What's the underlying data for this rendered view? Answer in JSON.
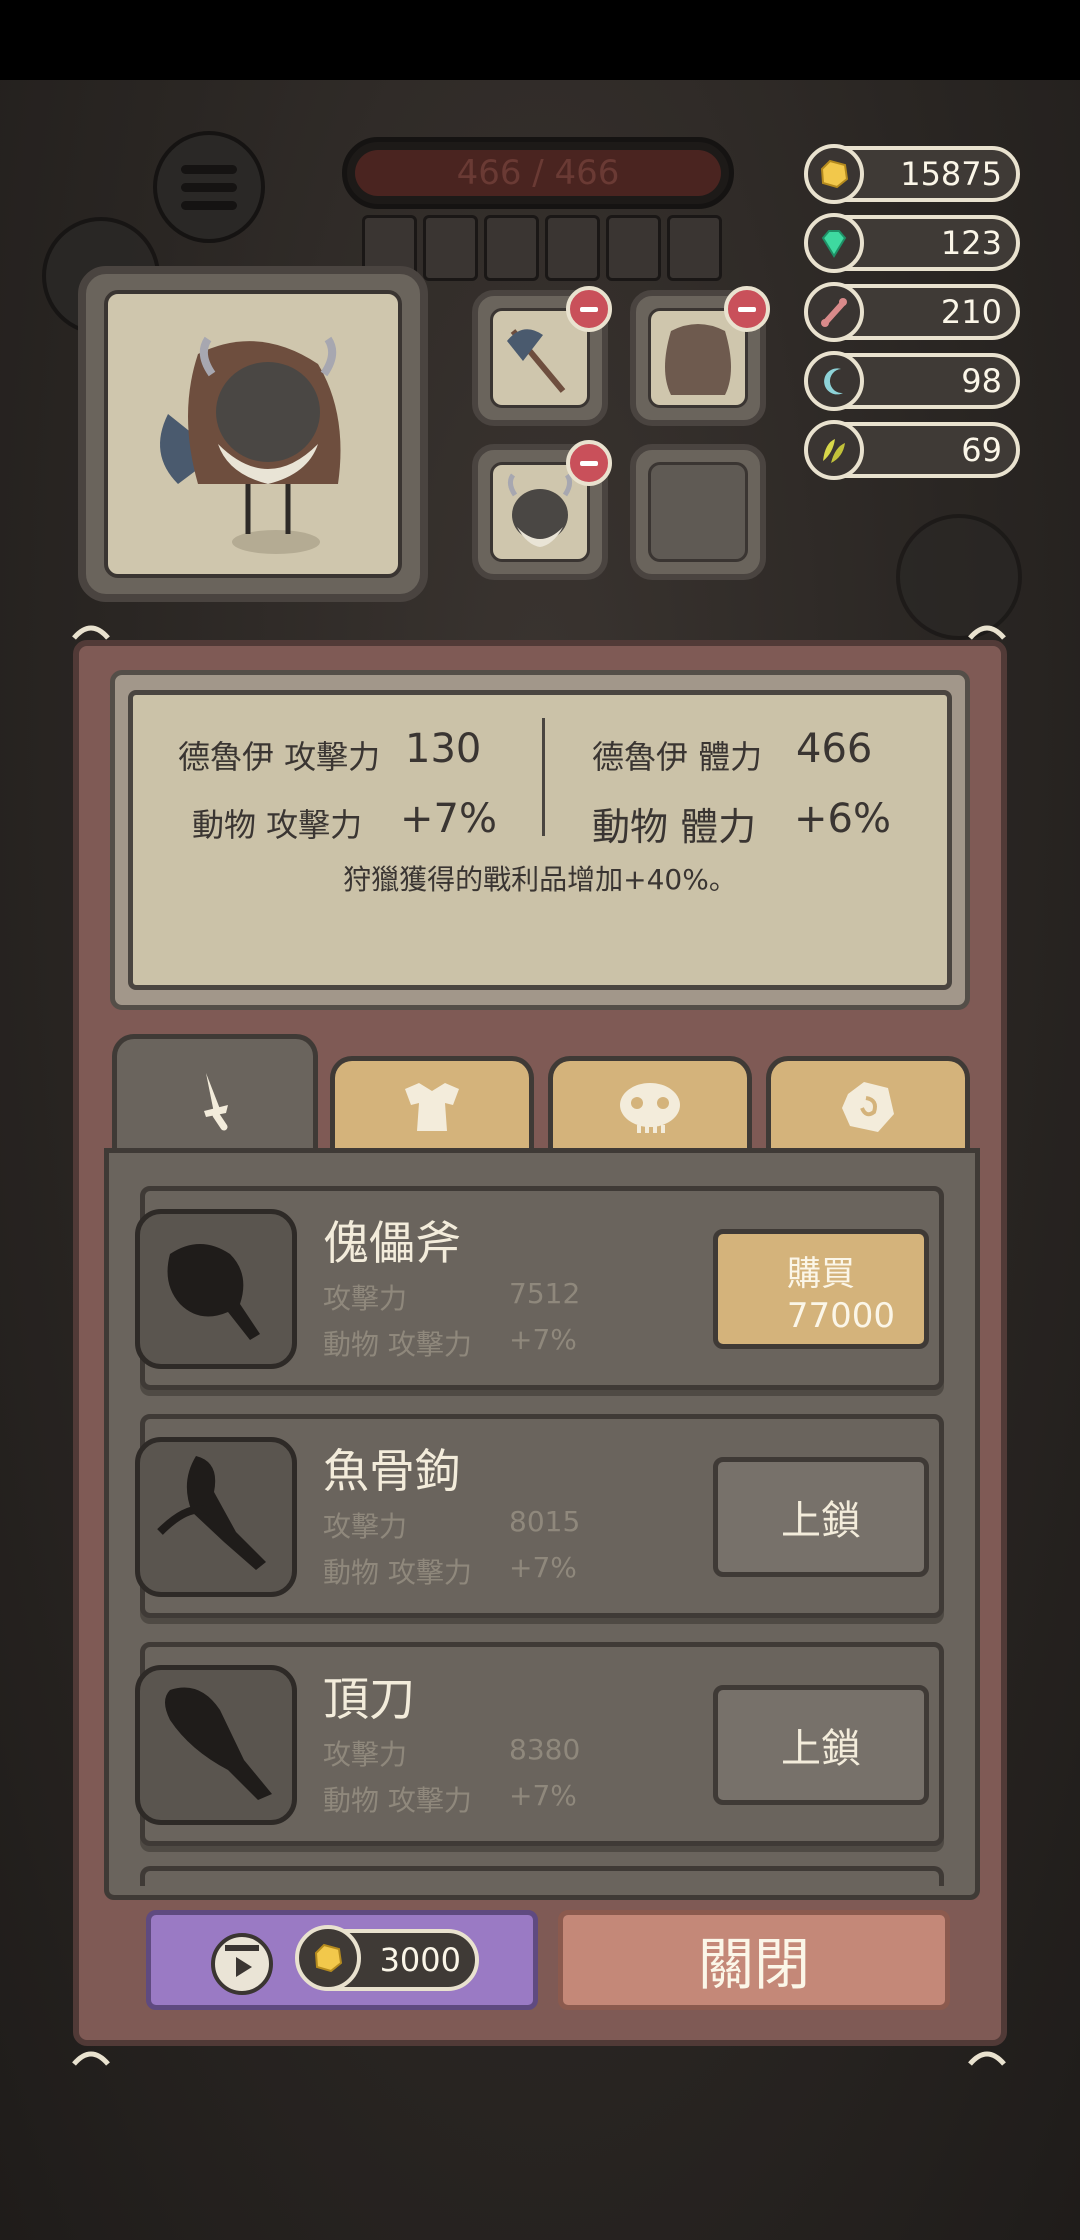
{
  "hud": {
    "hp_text": "466 / 466",
    "resources": [
      {
        "icon": "gold-icon",
        "value": "15875",
        "color": "#f2c84b"
      },
      {
        "icon": "gem-icon",
        "value": "123",
        "color": "#3ed9a0"
      },
      {
        "icon": "bone-icon",
        "value": "210",
        "color": "#d98a8a"
      },
      {
        "icon": "moon-claw-icon",
        "value": "98",
        "color": "#8ed3d8"
      },
      {
        "icon": "leaf-icon",
        "value": "69",
        "color": "#d8d84a"
      }
    ]
  },
  "stats": {
    "druid_attack_label": "德魯伊 攻擊力",
    "druid_attack_value": "130",
    "druid_hp_label": "德魯伊 體力",
    "druid_hp_value": "466",
    "animal_attack_label": "動物 攻擊力",
    "animal_attack_value": "+7%",
    "animal_hp_label": "動物 體力",
    "animal_hp_value": "+6%",
    "note": "狩獵獲得的戰利品增加+40%。"
  },
  "tabs": [
    {
      "name": "weapon",
      "icon": "sword-icon",
      "active": true
    },
    {
      "name": "armor",
      "icon": "armor-icon",
      "active": false
    },
    {
      "name": "mask",
      "icon": "mask-icon",
      "active": false
    },
    {
      "name": "accessory",
      "icon": "rune-icon",
      "active": false
    }
  ],
  "items": [
    {
      "name": "傀儡斧",
      "atk_label": "攻擊力",
      "atk_value": "7512",
      "animal_label": "動物 攻擊力",
      "animal_value": "+7%",
      "button": "購買",
      "price": "77000"
    },
    {
      "name": "魚骨鉤",
      "atk_label": "攻擊力",
      "atk_value": "8015",
      "animal_label": "動物 攻擊力",
      "animal_value": "+7%",
      "button": "上鎖"
    },
    {
      "name": "頂刀",
      "atk_label": "攻擊力",
      "atk_value": "8380",
      "animal_label": "動物 攻擊力",
      "animal_value": "+7%",
      "button": "上鎖"
    }
  ],
  "footer": {
    "ad_cost": "3000",
    "close_label": "關閉"
  },
  "colors": {
    "panel": "#7f5a55",
    "buy_button": "#d4b37b",
    "ad_button": "#9a7ac4",
    "close_button": "#c48878"
  }
}
